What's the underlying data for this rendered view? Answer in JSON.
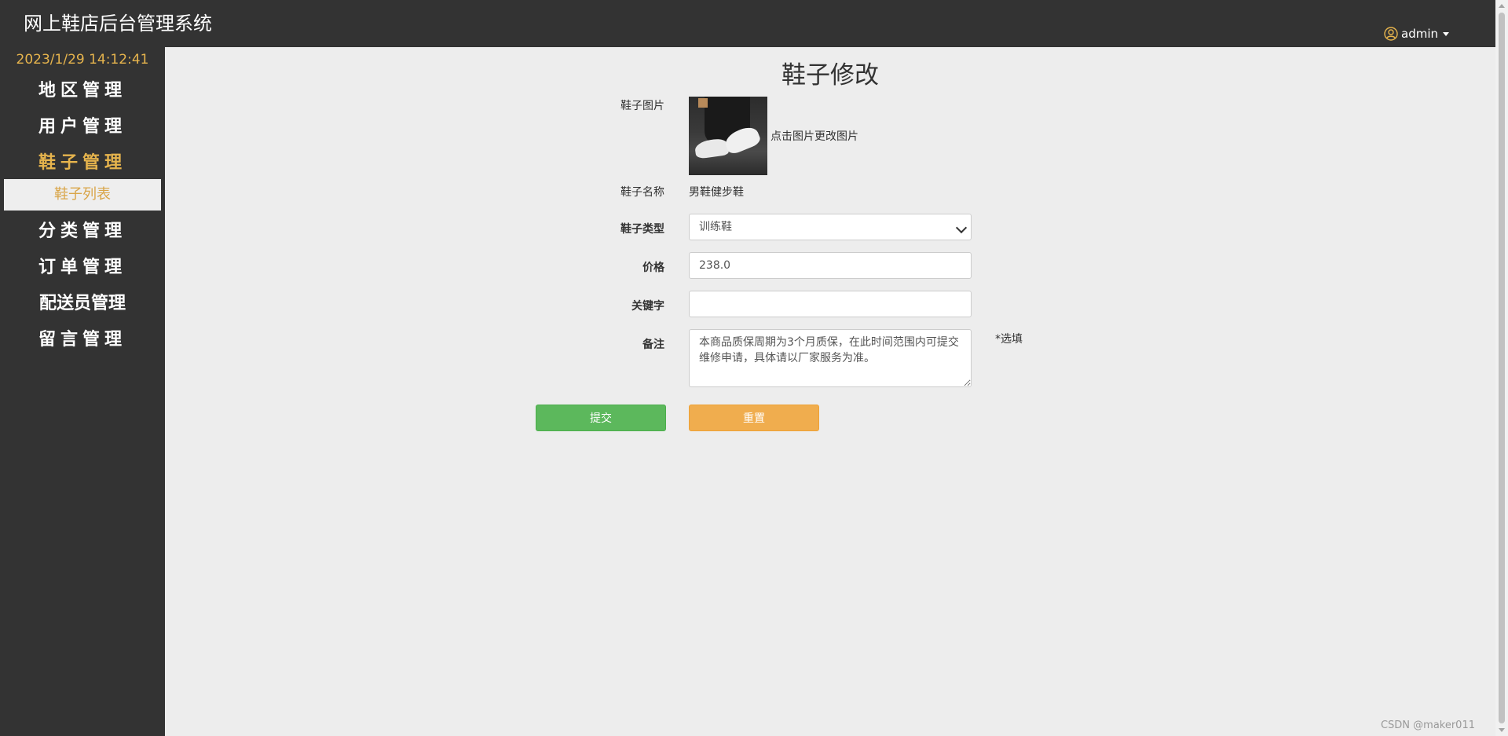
{
  "app": {
    "title": "网上鞋店后台管理系统",
    "user": "admin",
    "clock": "2023/1/29 14:12:41"
  },
  "sidebar": {
    "items": [
      {
        "label": "地区管理",
        "active": false
      },
      {
        "label": "用户管理",
        "active": false
      },
      {
        "label": "鞋子管理",
        "active": true
      },
      {
        "label": "分类管理",
        "active": false
      },
      {
        "label": "订单管理",
        "active": false
      },
      {
        "label": "配送员管理",
        "active": false
      },
      {
        "label": "留言管理",
        "active": false
      }
    ],
    "sub_item": "鞋子列表"
  },
  "form": {
    "title": "鞋子修改",
    "image_label": "鞋子图片",
    "image_hint": "点击图片更改图片",
    "name_label": "鞋子名称",
    "name_value": "男鞋健步鞋",
    "type_label": "鞋子类型",
    "type_value": "训练鞋",
    "price_label": "价格",
    "price_value": "238.0",
    "keyword_label": "关键字",
    "keyword_value": "",
    "remark_label": "备注",
    "remark_value": "本商品质保周期为3个月质保，在此时间范围内可提交维修申请，具体请以厂家服务为准。",
    "optional_note": "*选填",
    "submit_label": "提交",
    "reset_label": "重置"
  },
  "footer": {
    "watermark": "CSDN @maker011"
  },
  "colors": {
    "dark": "#333333",
    "accent": "#e6b44d",
    "submit": "#5cb85c",
    "reset": "#f0ad4e",
    "background": "#ededed"
  }
}
